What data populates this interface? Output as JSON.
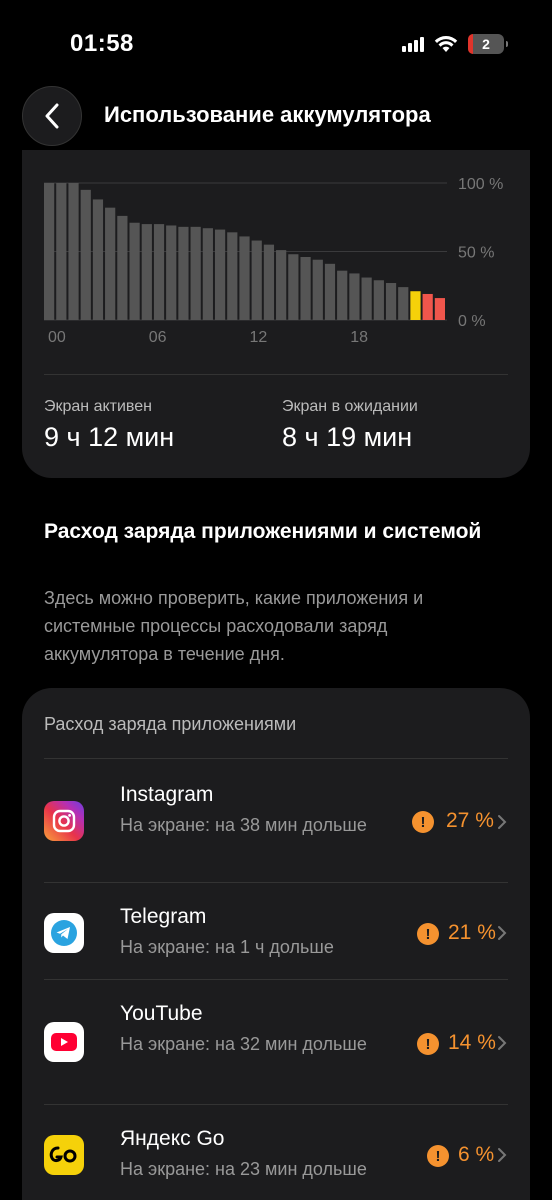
{
  "status": {
    "time": "01:58",
    "battery": "2"
  },
  "header": {
    "title": "Использование аккумулятора"
  },
  "chart_data": {
    "type": "bar",
    "y_ticks": [
      "100 %",
      "50 %",
      "0 %"
    ],
    "x_ticks": [
      "00",
      "06",
      "12",
      "18"
    ],
    "ylim": [
      0,
      100
    ],
    "values": [
      100,
      100,
      100,
      95,
      88,
      82,
      76,
      71,
      70,
      70,
      69,
      68,
      68,
      67,
      66,
      64,
      61,
      58,
      55,
      51,
      48,
      46,
      44,
      41,
      36,
      34,
      31,
      29,
      27,
      24,
      21,
      19,
      16
    ],
    "colors": [
      "#555555",
      "#555555",
      "#555555",
      "#555555",
      "#555555",
      "#555555",
      "#555555",
      "#555555",
      "#555555",
      "#555555",
      "#555555",
      "#555555",
      "#555555",
      "#555555",
      "#555555",
      "#555555",
      "#555555",
      "#555555",
      "#555555",
      "#555555",
      "#555555",
      "#555555",
      "#555555",
      "#555555",
      "#555555",
      "#555555",
      "#555555",
      "#555555",
      "#555555",
      "#555555",
      "#f5d10a",
      "#f0564c",
      "#f0564c"
    ]
  },
  "stats": {
    "active_label": "Экран активен",
    "active_value": "9 ч 12 мин",
    "idle_label": "Экран в ожидании",
    "idle_value": "8 ч 19 мин"
  },
  "section": {
    "title": "Расход заряда приложениями и системой",
    "description": "Здесь можно проверить, какие приложения и системные процессы расходовали заряд аккумулятора в течение дня."
  },
  "apps": {
    "card_title": "Расход заряда приложениями",
    "items": [
      {
        "name": "Instagram",
        "detail": "На экране: на 38 мин дольше",
        "percent": "27 %",
        "icon": "instagram-icon"
      },
      {
        "name": "Telegram",
        "detail": "На экране: на 1 ч дольше",
        "percent": "21 %",
        "icon": "telegram-icon"
      },
      {
        "name": "YouTube",
        "detail": "На экране: на 32 мин дольше",
        "percent": "14 %",
        "icon": "youtube-icon"
      },
      {
        "name": "Яндекс Go",
        "detail": "На экране: на 23 мин дольше",
        "percent": "6 %",
        "icon": "yandex-go-icon"
      }
    ],
    "warn_symbol": "!"
  },
  "colors": {
    "accent_warning": "#f5922f",
    "card_bg": "#1c1c1e"
  }
}
